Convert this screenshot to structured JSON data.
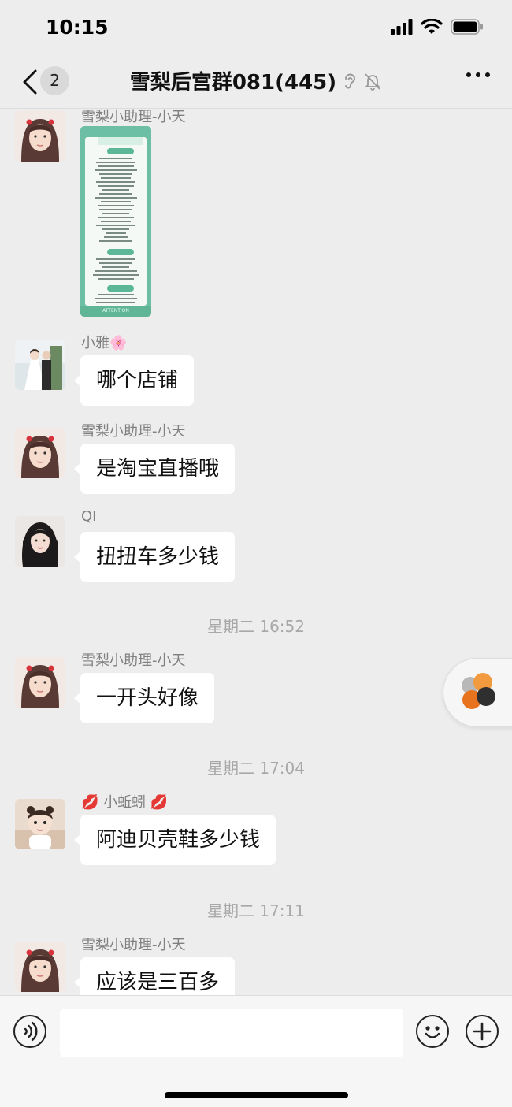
{
  "status_bar": {
    "time": "10:15"
  },
  "nav": {
    "unread_count": "2",
    "title": "雪梨后宫群081(445)"
  },
  "poster": {
    "footer_text": "ATTENTION"
  },
  "messages": [
    {
      "sender": "雪梨小助理-小天",
      "type": "image"
    },
    {
      "sender": "小雅🌸",
      "text": "哪个店铺"
    },
    {
      "sender": "雪梨小助理-小天",
      "text": "是淘宝直播哦"
    },
    {
      "sender": "QI",
      "text": "扭扭车多少钱"
    },
    {
      "timestamp": "星期二 16:52"
    },
    {
      "sender": "雪梨小助理-小天",
      "text": "一开头好像"
    },
    {
      "timestamp": "星期二 17:04"
    },
    {
      "sender": "💋 小蚯蚓 💋",
      "text": "阿迪贝壳鞋多少钱"
    },
    {
      "timestamp": "星期二 17:11"
    },
    {
      "sender": "雪梨小助理-小天",
      "text": "应该是三百多"
    }
  ],
  "icons": {
    "back": "chevron-left-icon",
    "ear": "ear-icon",
    "mute": "bell-off-icon",
    "more": "more-dots-icon",
    "voice": "voice-icon",
    "emoji": "emoji-icon",
    "plus": "plus-icon"
  },
  "colors": {
    "background": "#ededed",
    "bubble": "#ffffff",
    "sender_text": "#808080",
    "timestamp_text": "#a8a8a8"
  }
}
